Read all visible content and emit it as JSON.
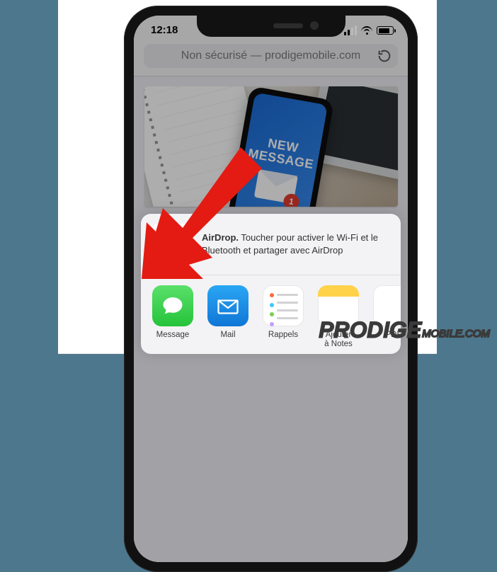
{
  "status": {
    "time": "12:18"
  },
  "browser": {
    "address_prefix": "Non sécurisé — ",
    "address_domain": "prodigemobile.com"
  },
  "hero": {
    "line1": "NEW",
    "line2": "MESSAGE",
    "badge": "1"
  },
  "share_sheet": {
    "airdrop_title": "AirDrop.",
    "airdrop_body_a": "Toucher pour activer le Wi-Fi et le",
    "airdrop_body_b": "Bluetooth et partager avec AirDrop",
    "apps": {
      "message": "Message",
      "mail": "Mail",
      "reminders": "Rappels",
      "notes_line1": "Ajouter",
      "notes_line2": "à Notes",
      "pdf": "PDF"
    }
  },
  "watermark": {
    "brand": "PRODIGE",
    "suffix": "MOBILE",
    "tld": ".COM"
  }
}
